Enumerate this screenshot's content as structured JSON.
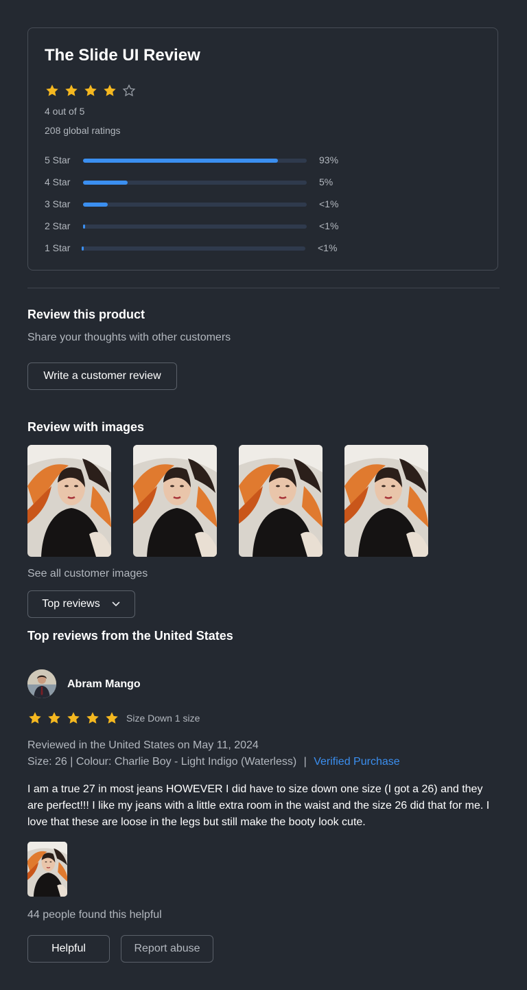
{
  "summary": {
    "title": "The Slide UI Review",
    "rating": 4,
    "max_rating": 5,
    "rating_text": "4 out of 5",
    "global_ratings": "208  global ratings",
    "bars": [
      {
        "label": "5 Star",
        "percent_text": "93%",
        "fill": 0.87
      },
      {
        "label": "4 Star",
        "percent_text": "5%",
        "fill": 0.2
      },
      {
        "label": "3 Star",
        "percent_text": "<1%",
        "fill": 0.11
      },
      {
        "label": "2 Star",
        "percent_text": "<1%",
        "fill": 0.008
      },
      {
        "label": "1 Star",
        "percent_text": "<1%",
        "fill": 0.008
      }
    ]
  },
  "review_product": {
    "heading": "Review this product",
    "subtext": "Share your thoughts with other customers",
    "button_label": "Write a customer review"
  },
  "images_section": {
    "heading": "Review with images",
    "see_all": "See all customer images"
  },
  "sort": {
    "selected": "Top reviews"
  },
  "reviews_heading": "Top reviews from the United States",
  "review": {
    "name": "Abram Mango",
    "rating": 5,
    "size_note": "Size Down 1 size",
    "reviewed_line": "Reviewed in the United States on May 11, 2024",
    "size_colour": "Size: 26 | Colour: Charlie Boy - Light Indigo (Waterless)",
    "separator": "|",
    "verified": "Verified Purchase",
    "body": "I am a true 27 in most jeans HOWEVER I did have to size down one size (I got a 26) and they are perfect!!! I like my jeans with a little extra room in the waist and the size 26 did that for me. I love that these are loose in the legs but still make the booty look cute.",
    "helpful_count": "44 people found this helpful",
    "helpful_button": "Helpful",
    "report_button": "Report abuse"
  },
  "colors": {
    "background": "#242931",
    "star": "#f5b820",
    "accent": "#3b8ff0"
  }
}
